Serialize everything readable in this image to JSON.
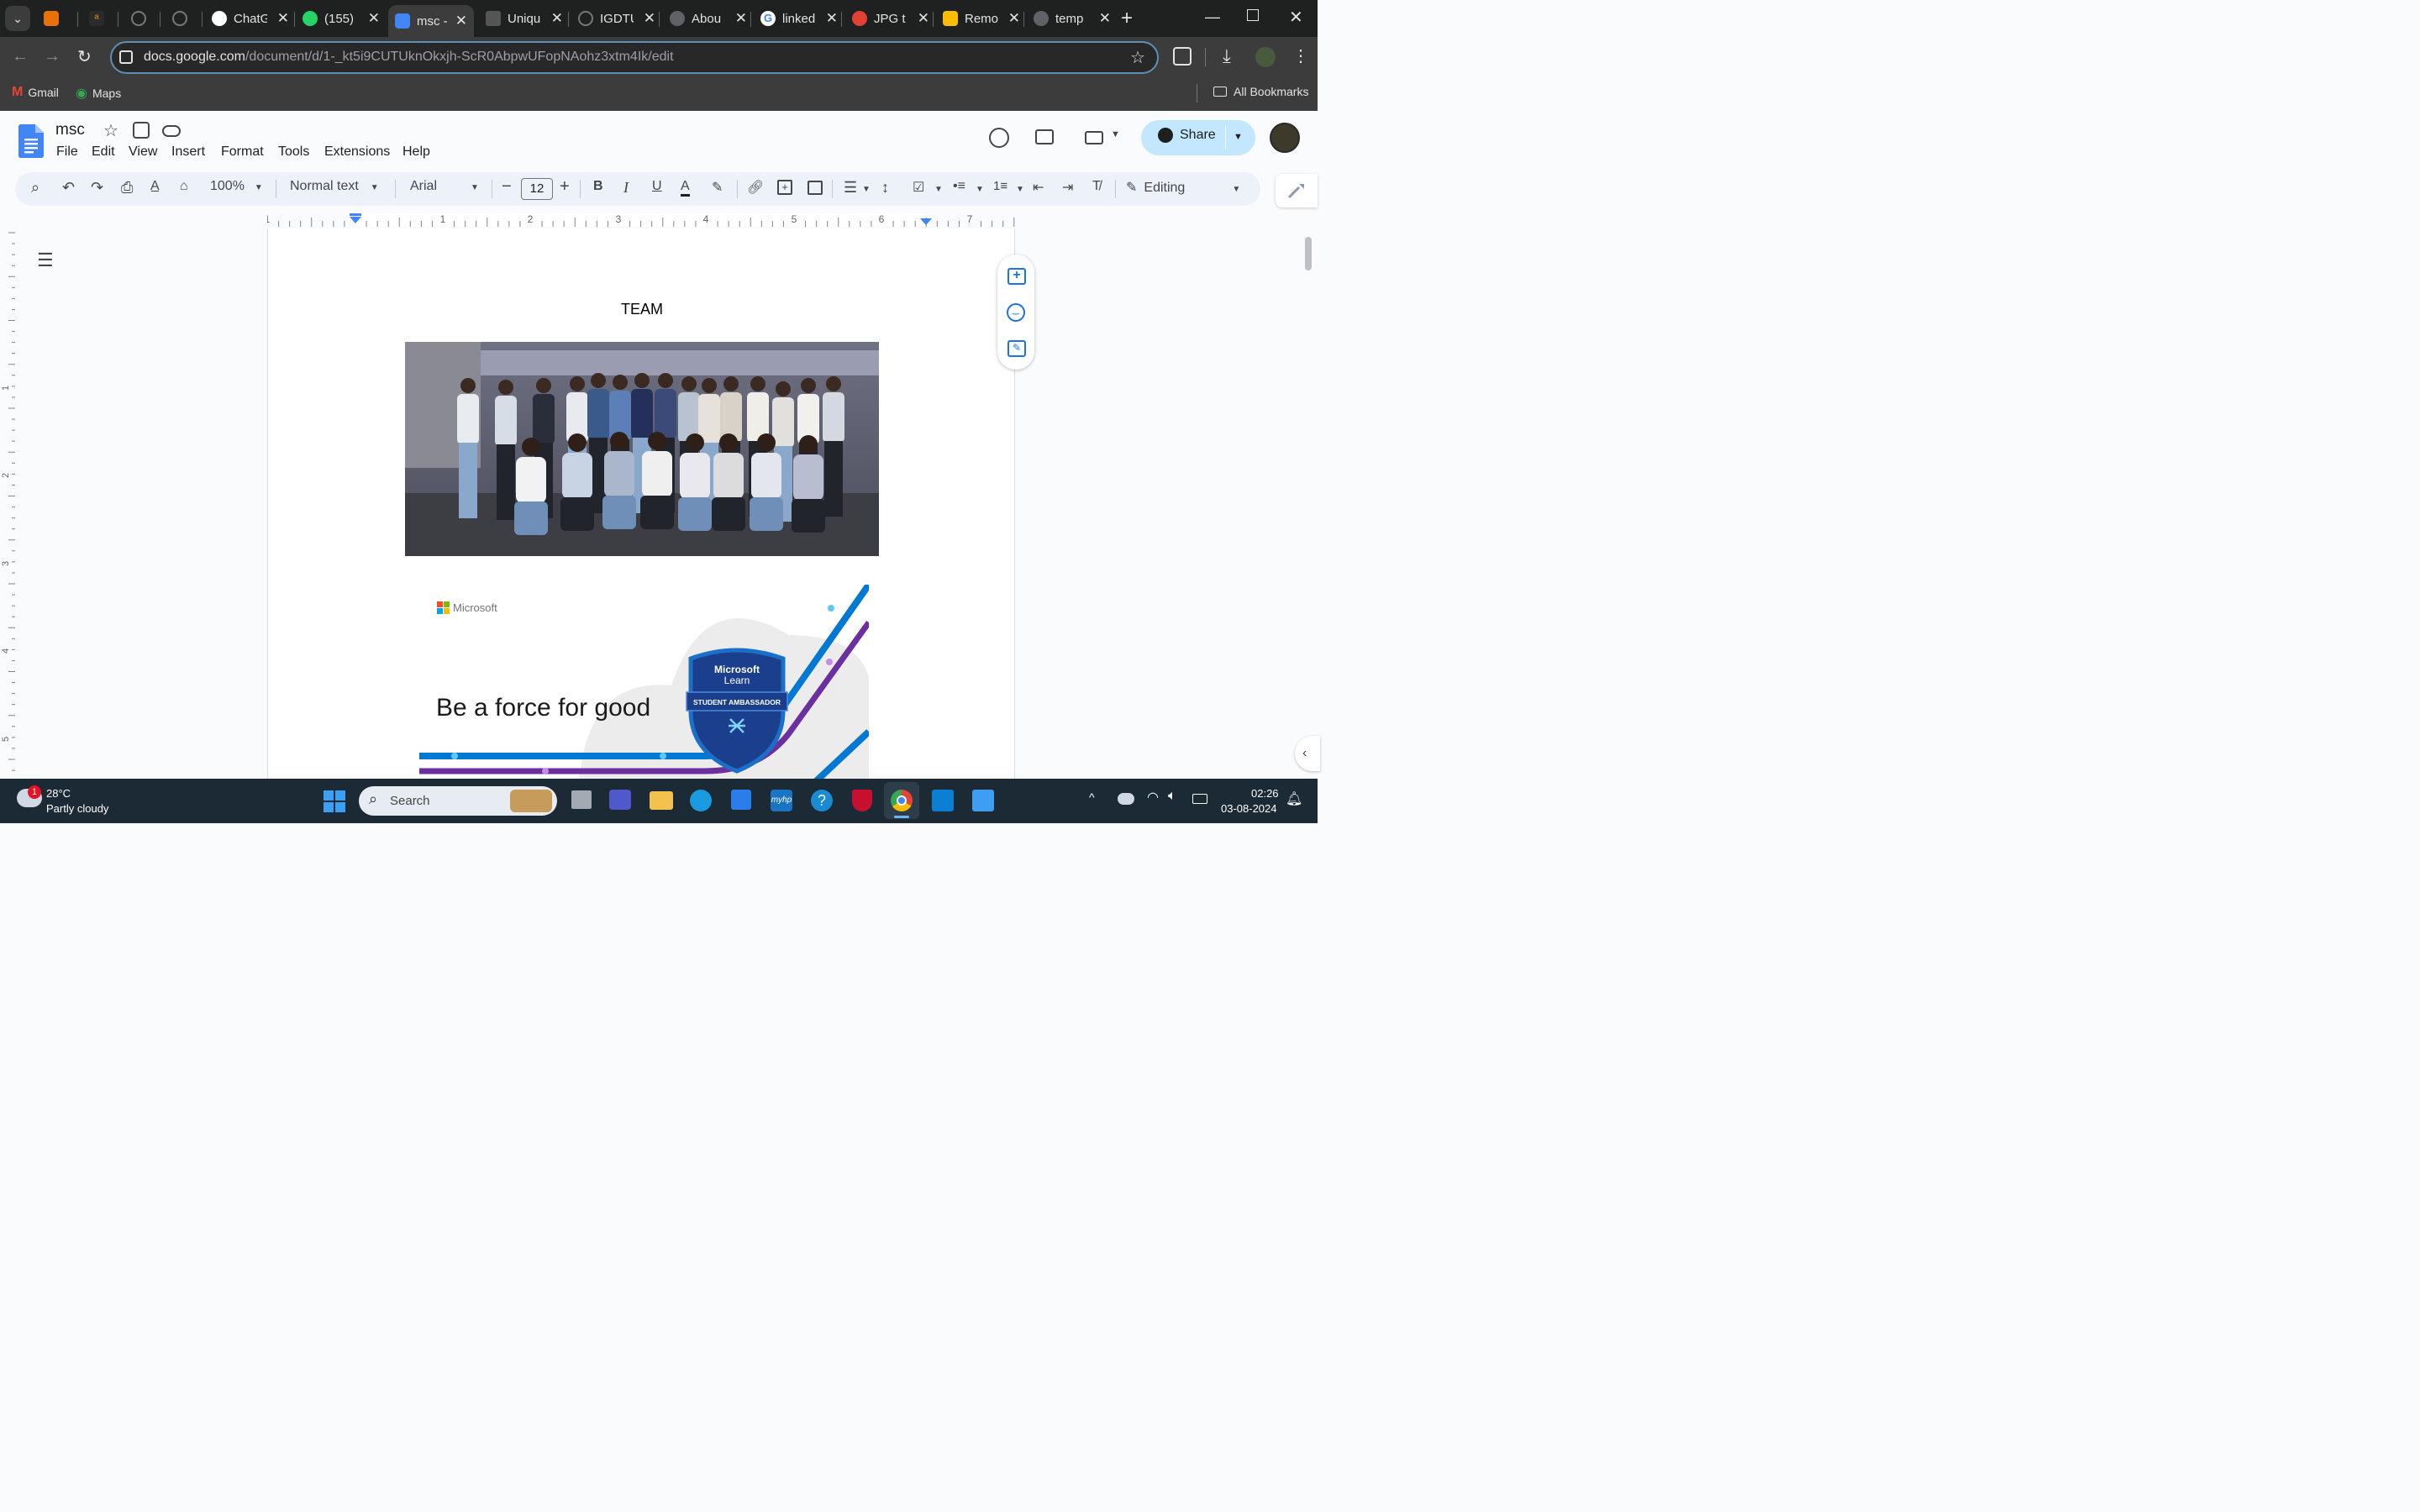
{
  "browser": {
    "tabs": [
      {
        "label": ""
      },
      {
        "label": ""
      },
      {
        "label": ""
      },
      {
        "label": ""
      },
      {
        "label": "ChatG"
      },
      {
        "label": "(155)"
      },
      {
        "label": "msc -"
      },
      {
        "label": "Uniqu"
      },
      {
        "label": "IGDTU"
      },
      {
        "label": "Abou"
      },
      {
        "label": "linked"
      },
      {
        "label": "JPG t"
      },
      {
        "label": "Remo"
      },
      {
        "label": "temp"
      }
    ],
    "url_host": "docs.google.com",
    "url_path": "/document/d/1-_kt5i9CUTUknOkxjh-ScR0AbpwUFopNAohz3xtm4Ik/edit",
    "bookmarks": [
      {
        "label": "Gmail"
      },
      {
        "label": "Maps"
      }
    ],
    "all_bookmarks": "All Bookmarks"
  },
  "docs": {
    "title": "msc",
    "menus": [
      "File",
      "Edit",
      "View",
      "Insert",
      "Format",
      "Tools",
      "Extensions",
      "Help"
    ],
    "share_label": "Share",
    "toolbar": {
      "zoom": "100%",
      "style": "Normal text",
      "font": "Arial",
      "font_size": "12",
      "mode": "Editing"
    },
    "ruler_numbers": [
      "1",
      "1",
      "2",
      "3",
      "4",
      "5",
      "6",
      "7"
    ],
    "left_ruler_numbers": [
      "1",
      "2",
      "3",
      "4",
      "5"
    ],
    "document": {
      "heading": "TEAM",
      "banner": {
        "brand": "Microsoft",
        "tagline": "Be a force for good",
        "badge_line1": "Microsoft",
        "badge_line2": "Learn",
        "badge_ribbon": "STUDENT AMBASSADOR"
      }
    }
  },
  "taskbar": {
    "weather_temp": "28°C",
    "weather_desc": "Partly cloudy",
    "weather_badge": "1",
    "search_placeholder": "Search",
    "time": "02:26",
    "date": "03-08-2024"
  },
  "colors": {
    "accent": "#1a73e8",
    "share_bg": "#c2e7ff",
    "toolbar_bg": "#edf2fa"
  }
}
